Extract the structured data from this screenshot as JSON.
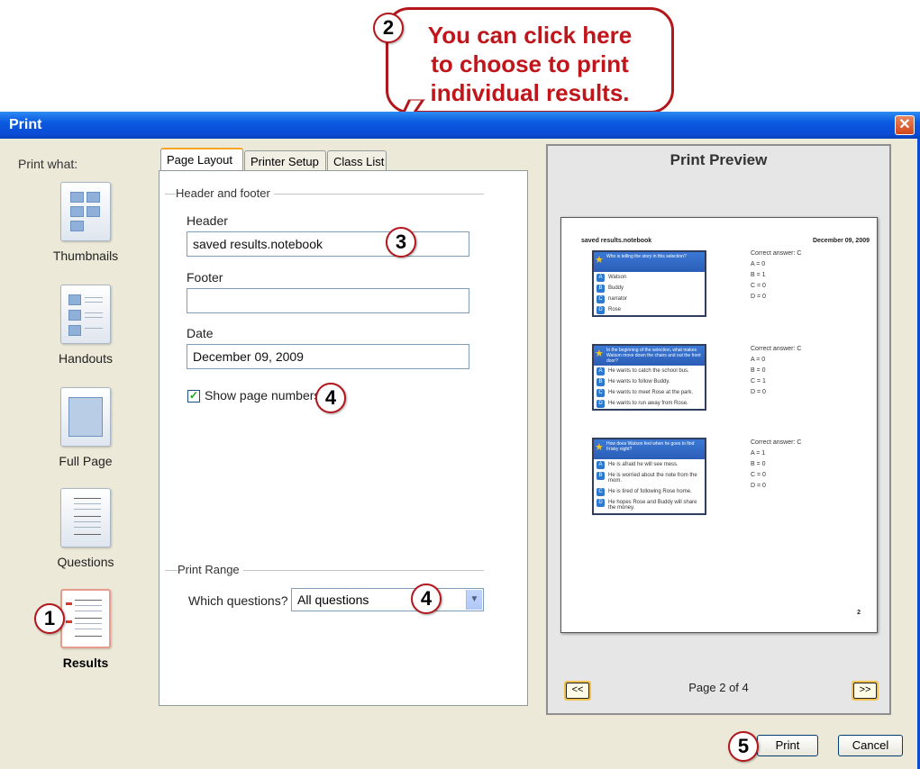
{
  "callout": {
    "number": "2",
    "lines": [
      "You can click here",
      "to choose to print",
      "individual results."
    ]
  },
  "markers": {
    "m1": "1",
    "m3": "3",
    "m4a": "4",
    "m4b": "4",
    "m5": "5"
  },
  "window": {
    "title": "Print",
    "close_glyph": "✕"
  },
  "left": {
    "print_what_label": "Print what:",
    "options": [
      {
        "label": "Thumbnails"
      },
      {
        "label": "Handouts"
      },
      {
        "label": "Full Page"
      },
      {
        "label": "Questions"
      },
      {
        "label": "Results"
      }
    ]
  },
  "tabs": [
    "Page Layout",
    "Printer Setup",
    "Class List"
  ],
  "page_layout": {
    "header_footer_group": "Header and footer",
    "header_label": "Header",
    "header_value": "saved results.notebook",
    "footer_label": "Footer",
    "footer_value": "",
    "date_label": "Date",
    "date_value": "December 09, 2009",
    "show_page_numbers_label": "Show page numbers",
    "show_page_numbers_checked": true,
    "print_range_group": "Print Range",
    "which_questions_label": "Which questions?",
    "which_questions_value": "All questions"
  },
  "preview": {
    "title": "Print Preview",
    "page_header_left": "saved results.notebook",
    "page_header_right": "December 09, 2009",
    "page_number": "2",
    "page_indicator": "Page 2 of 4",
    "prev_label": "<<",
    "next_label": ">>",
    "questions": [
      {
        "question": "Who is telling the story in this selection?",
        "options": [
          "Watson",
          "Buddy",
          "narrator",
          "Rose"
        ],
        "correct": "Correct answer: C",
        "counts": [
          "A = 0",
          "B = 1",
          "C = 0",
          "D = 0"
        ]
      },
      {
        "question": "In the beginning of the selection, what makes Watson move down the chairs and out the front door?",
        "options": [
          "He wants to catch the school bus.",
          "He wants to follow Buddy.",
          "He wants to meet Rose at the park.",
          "He wants to run away from Rose."
        ],
        "correct": "Correct answer: C",
        "counts": [
          "A = 0",
          "B = 0",
          "C = 1",
          "D = 0"
        ]
      },
      {
        "question": "How does Watson feel when he goes to find Frisky night?",
        "options": [
          "He is afraid he will see mess.",
          "He is worried about the note from the mom.",
          "He is tired of following Rose home.",
          "He hopes Rose and Buddy will share the money."
        ],
        "correct": "Correct answer: C",
        "counts": [
          "A = 1",
          "B = 0",
          "C = 0",
          "D = 0"
        ]
      }
    ]
  },
  "buttons": {
    "print": "Print",
    "cancel": "Cancel"
  },
  "colors": {
    "accent_red": "#b3161b",
    "titlebar_blue": "#0a4bd4",
    "dialog_bg": "#ece9d8"
  }
}
